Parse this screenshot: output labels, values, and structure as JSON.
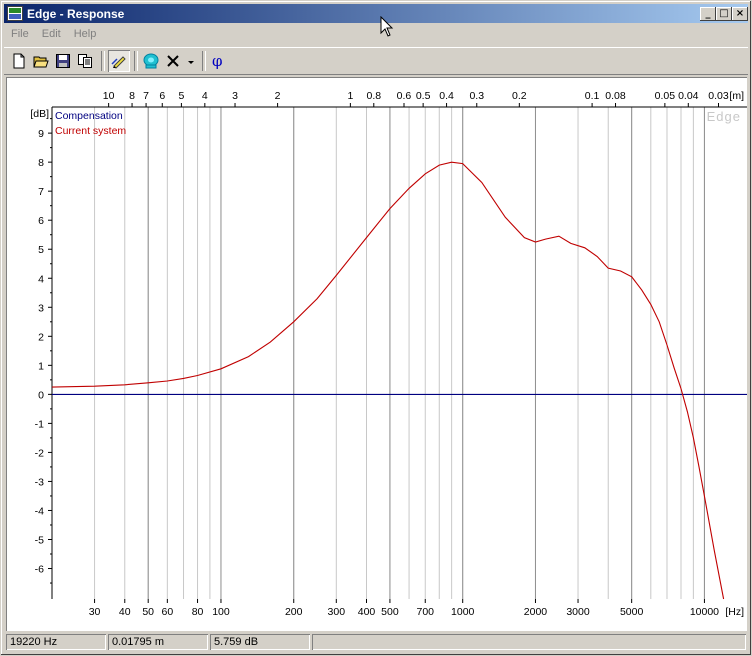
{
  "window": {
    "title": "Edge - Response",
    "buttons": [
      "_",
      "□",
      "×"
    ]
  },
  "menu": [
    "File",
    "Edit",
    "Help"
  ],
  "toolbar": {
    "buttons": [
      {
        "name": "new-icon"
      },
      {
        "name": "open-folder-icon"
      },
      {
        "name": "save-icon"
      },
      {
        "name": "copy-icon"
      },
      {
        "name": "pencil-icon"
      },
      {
        "name": "speaker-icon"
      },
      {
        "name": "x-icon"
      },
      {
        "name": "dropdown-arrow-icon"
      },
      {
        "name": "phase-icon",
        "label": "φ"
      }
    ]
  },
  "status": {
    "freq": "19220 Hz",
    "dist": "0.01795 m",
    "level": "5.759 dB",
    "extra": ""
  },
  "chart_data": {
    "type": "line",
    "xscale": "log",
    "xlim": [
      20,
      15000
    ],
    "ylim": [
      -7,
      10
    ],
    "xlabel": "[Hz]",
    "ylabel": "[dB]",
    "top_axis_label": "[m]",
    "watermark": "Edge",
    "x_ticks": [
      30,
      40,
      50,
      60,
      80,
      100,
      200,
      300,
      400,
      500,
      700,
      1000,
      2000,
      3000,
      5000,
      10000
    ],
    "x_tick_labels": [
      "30",
      "40",
      "50",
      "60",
      "80",
      "100",
      "200",
      "300",
      "400",
      "500",
      "700",
      "1000",
      "2000",
      "3000",
      "5000",
      "10000"
    ],
    "x_minor_grid": [
      20,
      30,
      40,
      50,
      60,
      70,
      80,
      90,
      100,
      200,
      300,
      400,
      500,
      600,
      700,
      800,
      900,
      1000,
      2000,
      3000,
      4000,
      5000,
      6000,
      7000,
      8000,
      9000,
      10000
    ],
    "x_major_grid": [
      50,
      100,
      200,
      500,
      1000,
      2000,
      5000,
      10000
    ],
    "y_ticks": [
      9,
      8,
      7,
      6,
      5,
      4,
      3,
      2,
      1,
      0,
      -1,
      -2,
      -3,
      -4,
      -5,
      -6
    ],
    "y_tick_labels": [
      "9",
      "8",
      "7",
      "6",
      "5",
      "4",
      "3",
      "2",
      "1",
      "0",
      "-1",
      "-2",
      "-3",
      "-4",
      "-5",
      "-6"
    ],
    "top_ticks": [
      10,
      8,
      7,
      6,
      5,
      4,
      3,
      2,
      1,
      0.8,
      0.6,
      0.5,
      0.4,
      0.3,
      0.2,
      0.1,
      0.08,
      0.05,
      0.04,
      0.03
    ],
    "top_tick_labels": [
      "10",
      "8",
      "7",
      "6",
      "5",
      "4",
      "3",
      "2",
      "1",
      "0.8",
      "0.6",
      "0.5",
      "0.4",
      "0.3",
      "0.2",
      "0.1",
      "0.08",
      "0.05",
      "0.04",
      "0.03"
    ],
    "series": [
      {
        "name": "Compensation",
        "color": "#000080",
        "x": [
          20,
          15000
        ],
        "y": [
          0,
          0
        ]
      },
      {
        "name": "Current system",
        "color": "#c00000",
        "x": [
          20,
          30,
          40,
          50,
          60,
          70,
          80,
          100,
          130,
          160,
          200,
          250,
          300,
          400,
          500,
          600,
          700,
          800,
          900,
          1000,
          1200,
          1500,
          1800,
          2000,
          2200,
          2500,
          2800,
          3200,
          3600,
          4000,
          4500,
          5000,
          5500,
          6000,
          6500,
          7000,
          7500,
          8000,
          8500,
          9000,
          9500,
          10000,
          11000,
          12000
        ],
        "y": [
          0.25,
          0.28,
          0.33,
          0.4,
          0.46,
          0.55,
          0.65,
          0.88,
          1.3,
          1.8,
          2.5,
          3.3,
          4.1,
          5.4,
          6.4,
          7.1,
          7.6,
          7.9,
          8.0,
          7.95,
          7.3,
          6.1,
          5.4,
          5.25,
          5.35,
          5.45,
          5.2,
          5.05,
          4.75,
          4.35,
          4.25,
          4.05,
          3.6,
          3.1,
          2.5,
          1.7,
          0.9,
          0.2,
          -0.6,
          -1.5,
          -2.5,
          -3.5,
          -5.4,
          -7.1
        ]
      }
    ],
    "legend": "top-left"
  }
}
